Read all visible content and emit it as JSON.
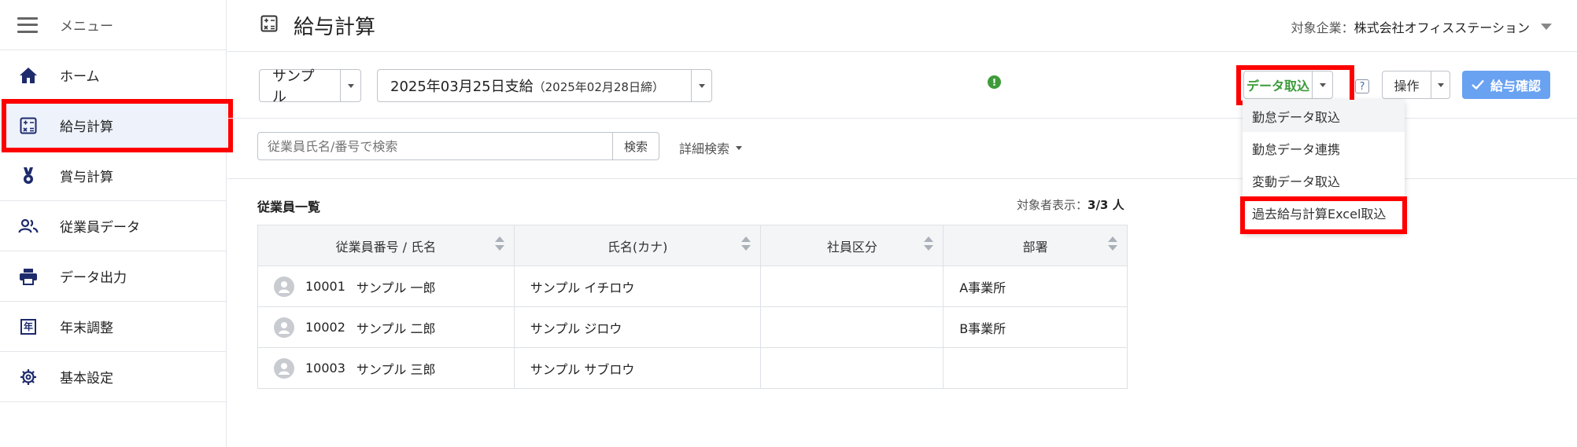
{
  "sidebar": {
    "menu_label": "メニュー",
    "items": [
      {
        "label": "ホーム",
        "icon": "home-icon"
      },
      {
        "label": "給与計算",
        "icon": "calculator-icon"
      },
      {
        "label": "賞与計算",
        "icon": "medal-icon"
      },
      {
        "label": "従業員データ",
        "icon": "people-icon"
      },
      {
        "label": "データ出力",
        "icon": "printer-icon"
      },
      {
        "label": "年末調整",
        "icon": "year-icon"
      },
      {
        "label": "基本設定",
        "icon": "gear-icon"
      }
    ],
    "year_glyph": "年"
  },
  "header": {
    "title": "給与計算",
    "company_key": "対象企業：",
    "company_value": "株式会社オフィスステーション"
  },
  "toolbar": {
    "sample_select": "サンプル",
    "payday_main": "2025年03月25日支給",
    "payday_sub": "（2025年02月28日締）",
    "alert_glyph": "!",
    "data_import": "データ取込",
    "help": "?",
    "operation": "操作",
    "confirm": "給与確認"
  },
  "data_menu": {
    "items": [
      "勤怠データ取込",
      "勤怠データ連携",
      "変動データ取込",
      "過去給与計算Excel取込"
    ]
  },
  "search": {
    "placeholder": "従業員氏名/番号で検索",
    "button": "検索",
    "advanced": "詳細検索"
  },
  "employees": {
    "title": "従業員一覧",
    "count_label": "対象者表示：",
    "count_value": "3/3 人",
    "columns": [
      "従業員番号 / 氏名",
      "氏名(カナ)",
      "社員区分",
      "部署"
    ],
    "rows": [
      {
        "number": "10001",
        "name": "サンプル 一郎",
        "kana": "サンプル イチロウ",
        "category": "",
        "dept": "A事業所"
      },
      {
        "number": "10002",
        "name": "サンプル 二郎",
        "kana": "サンプル ジロウ",
        "category": "",
        "dept": "B事業所"
      },
      {
        "number": "10003",
        "name": "サンプル 三郎",
        "kana": "サンプル サブロウ",
        "category": "",
        "dept": ""
      }
    ]
  },
  "colors": {
    "accent_green": "#3b9b3a",
    "confirm_blue": "#6aa2f2",
    "nav_icon": "#1d2a6b",
    "highlight": "#ff0000"
  }
}
